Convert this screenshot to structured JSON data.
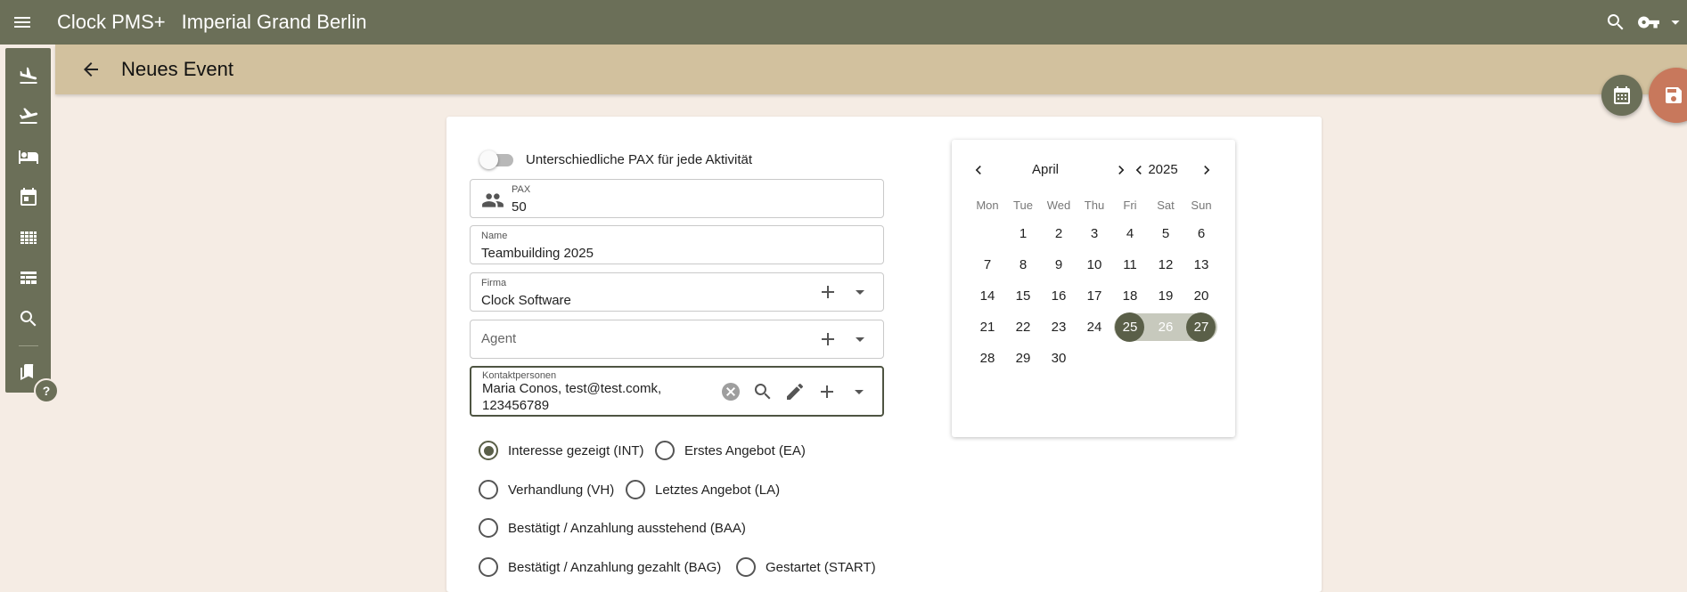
{
  "app": {
    "title": "Clock PMS+",
    "hotel": "Imperial Grand Berlin"
  },
  "topbar_icons": [
    "menu-icon",
    "search-icon",
    "key-icon",
    "chevron-down-icon"
  ],
  "page": {
    "title": "Neues Event"
  },
  "sidebar": {
    "items": [
      {
        "icon": "flight-land-icon"
      },
      {
        "icon": "flight-takeoff-icon"
      },
      {
        "icon": "bed-icon"
      },
      {
        "icon": "calendar-icon"
      },
      {
        "icon": "grid-icon"
      },
      {
        "icon": "table-icon"
      },
      {
        "icon": "search-icon"
      },
      {
        "icon": "bookmarks-icon"
      }
    ],
    "help": "?"
  },
  "form": {
    "toggle_label": "Unterschiedliche PAX für jede Aktivität",
    "toggle_on": false,
    "pax": {
      "label": "PAX",
      "value": "50"
    },
    "name": {
      "label": "Name",
      "value": "Teambuilding 2025"
    },
    "firma": {
      "label": "Firma",
      "value": "Clock Software"
    },
    "agent": {
      "placeholder": "Agent"
    },
    "kontakt": {
      "label": "Kontaktpersonen",
      "value": "Maria Conos, test@test.comk, 123456789"
    },
    "status_options": [
      {
        "label": "Interesse gezeigt (INT)",
        "selected": true
      },
      {
        "label": "Erstes Angebot (EA)",
        "selected": false
      },
      {
        "label": "Verhandlung (VH)",
        "selected": false
      },
      {
        "label": "Letztes Angebot (LA)",
        "selected": false
      },
      {
        "label": "Bestätigt / Anzahlung ausstehend (BAA)",
        "selected": false
      },
      {
        "label": "Bestätigt / Anzahlung gezahlt (BAG)",
        "selected": false
      },
      {
        "label": "Gestartet (START)",
        "selected": false
      }
    ]
  },
  "calendar": {
    "month": "April",
    "year": "2025",
    "weekdays": [
      "Mon",
      "Tue",
      "Wed",
      "Thu",
      "Fri",
      "Sat",
      "Sun"
    ],
    "weeks": [
      [
        "",
        "1",
        "2",
        "3",
        "4",
        "5",
        "6"
      ],
      [
        "7",
        "8",
        "9",
        "10",
        "11",
        "12",
        "13"
      ],
      [
        "14",
        "15",
        "16",
        "17",
        "18",
        "19",
        "20"
      ],
      [
        "21",
        "22",
        "23",
        "24",
        "25",
        "26",
        "27"
      ],
      [
        "28",
        "29",
        "30",
        "",
        "",
        "",
        ""
      ]
    ],
    "range_start": "25",
    "range_end": "27"
  },
  "colors": {
    "primary": "#6b6f58",
    "subheader": "#d2c19e",
    "background": "#f5ece4",
    "save_fab": "#c8785c"
  }
}
